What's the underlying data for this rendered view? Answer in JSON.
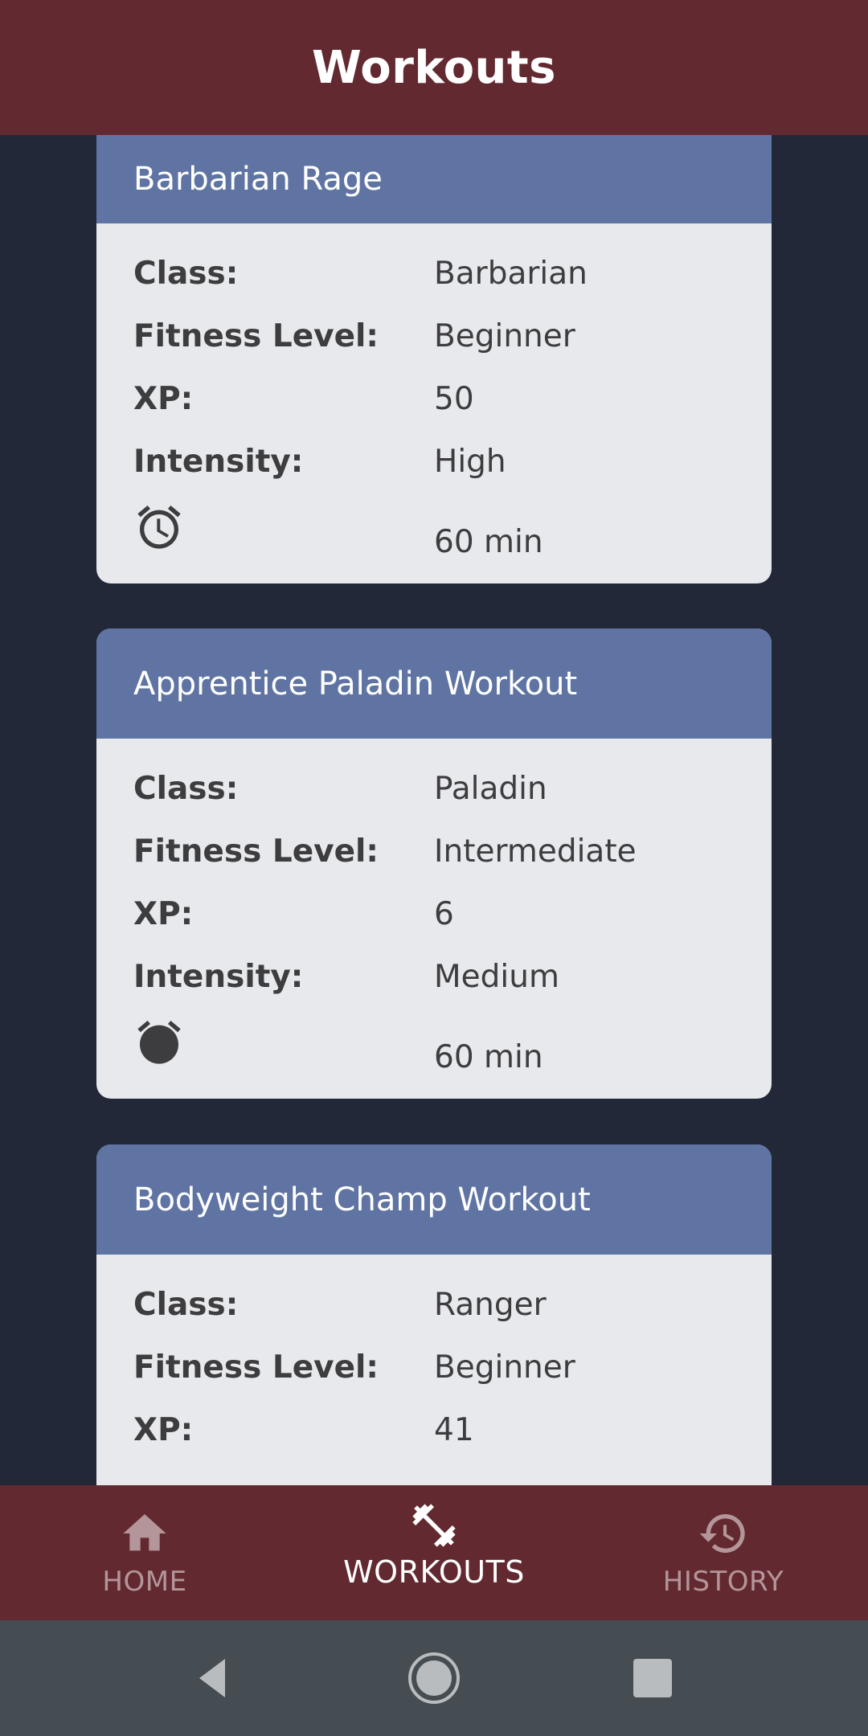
{
  "app_bar": {
    "title": "Workouts"
  },
  "workouts": [
    {
      "title": "Barbarian Rage",
      "class_label": "Class:",
      "class_value": "Barbarian",
      "fitness_label": "Fitness Level:",
      "fitness_value": "Beginner",
      "xp_label": "XP:",
      "xp_value": "50",
      "intensity_label": "Intensity:",
      "intensity_value": "High",
      "duration_icon": "alarm-clock-icon",
      "duration_value": "60 min"
    },
    {
      "title": "Apprentice Paladin Workout",
      "class_label": "Class:",
      "class_value": "Paladin",
      "fitness_label": "Fitness Level:",
      "fitness_value": "Intermediate",
      "xp_label": "XP:",
      "xp_value": "6",
      "intensity_label": "Intensity:",
      "intensity_value": "Medium",
      "duration_icon": "alarm-clock-icon",
      "duration_value": "60 min"
    },
    {
      "title": "Bodyweight Champ Workout",
      "class_label": "Class:",
      "class_value": "Ranger",
      "fitness_label": "Fitness Level:",
      "fitness_value": "Beginner",
      "xp_label": "XP:",
      "xp_value": "41"
    }
  ],
  "bottom_nav": {
    "items": [
      {
        "label": "HOME",
        "icon": "home-icon",
        "active": false
      },
      {
        "label": "WORKOUTS",
        "icon": "dumbbell-icon",
        "active": true
      },
      {
        "label": "HISTORY",
        "icon": "history-icon",
        "active": false
      }
    ]
  },
  "system_nav": {
    "buttons": [
      "back-icon",
      "home-circle-icon",
      "recents-icon"
    ]
  },
  "colors": {
    "app_bar": "#622a30",
    "background": "#222838",
    "card_header": "#5f74a3",
    "card_body": "#e8e9ed",
    "nav_active": "#ffffff",
    "nav_inactive": "#b3959a",
    "system_bar": "#454c52"
  }
}
